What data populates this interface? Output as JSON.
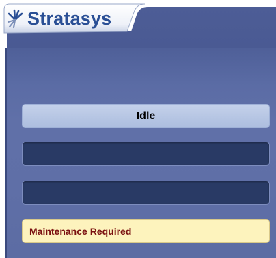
{
  "brand": {
    "name": "Stratasys",
    "logo_icon": "stratasys-logo-icon"
  },
  "status": {
    "label": "Idle"
  },
  "info_fields": [
    {
      "value": ""
    },
    {
      "value": ""
    }
  ],
  "alert": {
    "label": "Maintenance Required"
  },
  "colors": {
    "brand_blue": "#2a4f95",
    "panel": "#5b6ca5",
    "status_box": "#b8c7e4",
    "empty_box": "#293a65",
    "alert_bg": "#fdf3bd",
    "alert_text": "#7a1010"
  }
}
